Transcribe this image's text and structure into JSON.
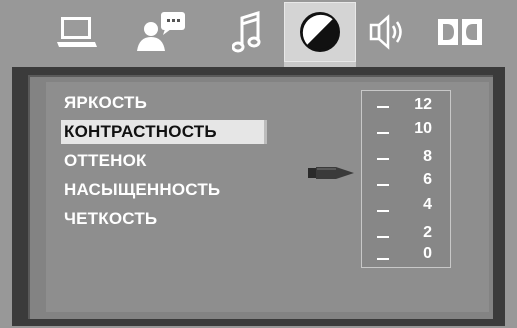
{
  "tabs": [
    {
      "name": "tab-general",
      "icon": "monitor-icon"
    },
    {
      "name": "tab-language",
      "icon": "speaking-person-icon"
    },
    {
      "name": "tab-audio",
      "icon": "music-note-icon"
    },
    {
      "name": "tab-video",
      "icon": "contrast-icon",
      "active": true
    },
    {
      "name": "tab-speaker",
      "icon": "speaker-icon"
    },
    {
      "name": "tab-dolby",
      "icon": "dolby-logo-icon"
    }
  ],
  "menu": {
    "items": [
      {
        "label": "ЯРКОСТЬ"
      },
      {
        "label": "КОНТРАСТНОСТЬ",
        "selected": true
      },
      {
        "label": "ОТТЕНОК"
      },
      {
        "label": "НАСЫЩЕННОСТЬ"
      },
      {
        "label": "ЧЕТКОСТЬ"
      }
    ]
  },
  "scale": {
    "labels": [
      "12",
      "10",
      "8",
      "6",
      "4",
      "2",
      "0"
    ],
    "pointer_value": 6
  },
  "colors": {
    "highlight": "#e6e6e6",
    "panel": "#8e8e8e",
    "frame": "#3b3b3b"
  }
}
